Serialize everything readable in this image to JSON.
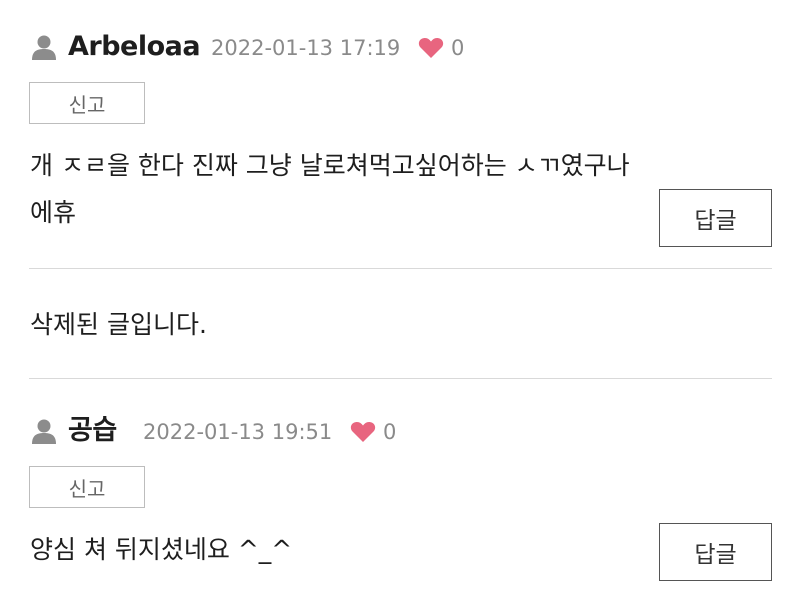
{
  "comments": [
    {
      "author": "Arbeloaa",
      "timestamp": "2022-01-13 17:19",
      "likes": "0",
      "report_label": "신고",
      "text_line1": "개 ㅈㄹ을 한다 진짜 그냥 날로쳐먹고싶어하는 ㅅㄲ였구나",
      "text_line2": "에휴",
      "reply_label": "답글"
    },
    {
      "deleted_text": "삭제된 글입니다."
    },
    {
      "author": "공습",
      "timestamp": "2022-01-13 19:51",
      "likes": "0",
      "report_label": "신고",
      "text_line1": "양심 쳐 뒤지셨네요 ^_^",
      "reply_label": "답글"
    }
  ],
  "colors": {
    "heart": "#e8657f",
    "user_icon": "#8c8c8c",
    "divider": "#d9d9d9"
  },
  "icons": {
    "user": "user-icon",
    "like": "heart-icon"
  }
}
